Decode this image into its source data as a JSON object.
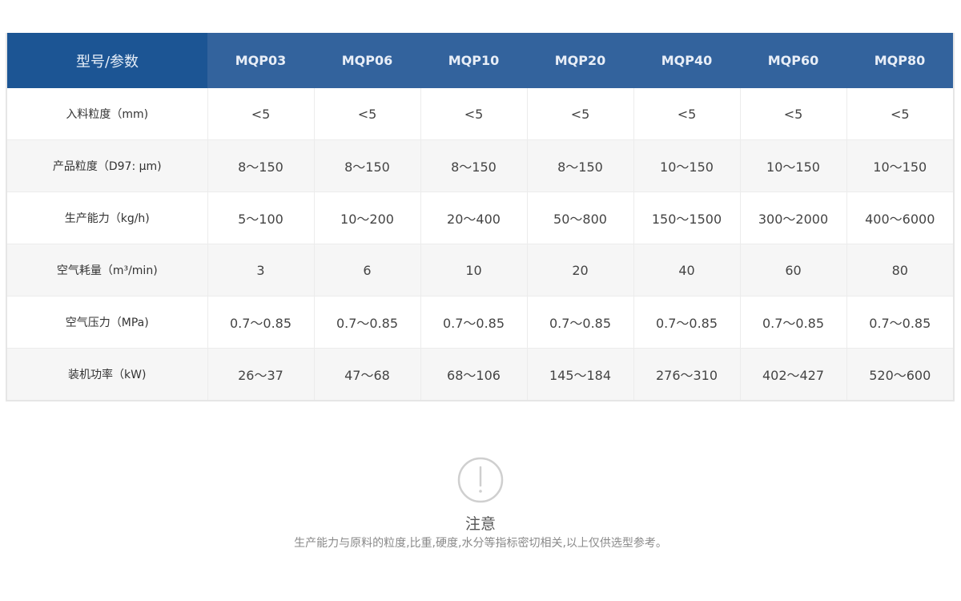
{
  "table": {
    "header_label": "型号/参数",
    "models": [
      "MQP03",
      "MQP06",
      "MQP10",
      "MQP20",
      "MQP40",
      "MQP60",
      "MQP80"
    ],
    "rows": [
      {
        "label": "入料粒度（mm)",
        "values": [
          "<5",
          "<5",
          "<5",
          "<5",
          "<5",
          "<5",
          "<5"
        ]
      },
      {
        "label": "产品粒度（D97: μm)",
        "values": [
          "8～150",
          "8～150",
          "8～150",
          "8～150",
          "10～150",
          "10～150",
          "10～150"
        ]
      },
      {
        "label": "生产能力（kg/h)",
        "values": [
          "5～100",
          "10～200",
          "20～400",
          "50～800",
          "150～1500",
          "300～2000",
          "400～6000"
        ]
      },
      {
        "label": "空气耗量（m³/min)",
        "values": [
          "3",
          "6",
          "10",
          "20",
          "40",
          "60",
          "80"
        ]
      },
      {
        "label": "空气压力（MPa)",
        "values": [
          "0.7～0.85",
          "0.7～0.85",
          "0.7～0.85",
          "0.7～0.85",
          "0.7～0.85",
          "0.7～0.85",
          "0.7～0.85"
        ]
      },
      {
        "label": "装机功率（kW)",
        "values": [
          "26～37",
          "47～68",
          "68～106",
          "145～184",
          "276～310",
          "402～427",
          "520～600"
        ]
      }
    ]
  },
  "notice": {
    "icon": "exclamation-circle-icon",
    "title": "注意",
    "text": "生产能力与原料的粒度,比重,硬度,水分等指标密切相关,以上仅供选型参考。"
  }
}
